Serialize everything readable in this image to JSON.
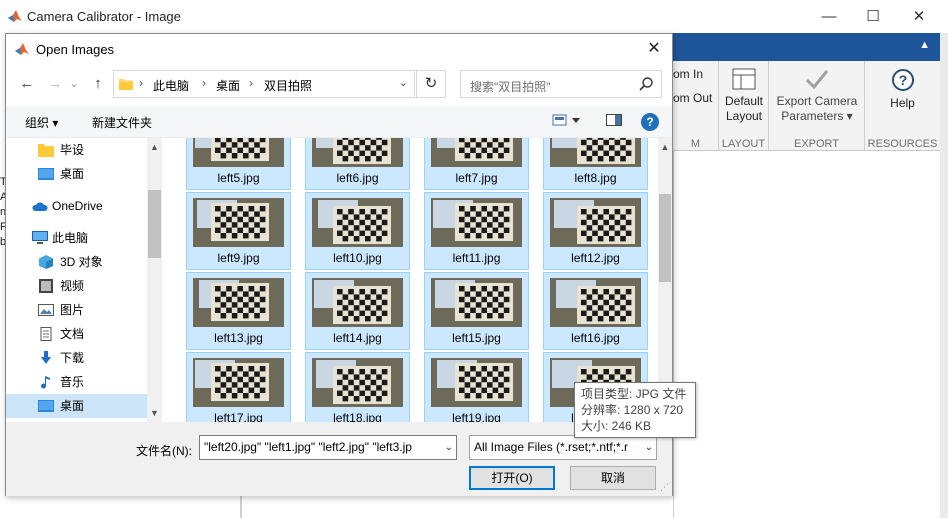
{
  "app": {
    "title": "Camera Calibrator - Image",
    "window_buttons": [
      "—",
      "☐",
      "✕"
    ],
    "ribbon": {
      "partial_labels": [
        "om In",
        "om Out",
        "M"
      ],
      "sections": [
        {
          "label": "LAYOUT",
          "button": "Default\nLayout"
        },
        {
          "label": "EXPORT",
          "button": "Export Camera\nParameters ▾"
        },
        {
          "label": "RESOURCES",
          "button": "Help"
        }
      ]
    },
    "left_strip_chars": [
      "T",
      "A",
      "n",
      "F",
      "b"
    ]
  },
  "dialog": {
    "title": "Open Images",
    "close_glyph": "✕",
    "nav": {
      "back_glyph": "←",
      "forward_glyph": "→",
      "recent_glyph": "⌄",
      "up_glyph": "↑",
      "breadcrumbs": [
        "此电脑",
        "桌面",
        "双目拍照"
      ],
      "search_placeholder": "搜索\"双目拍照\""
    },
    "toolbar": {
      "organize": "组织 ▾",
      "new_folder": "新建文件夹",
      "help": "?"
    },
    "nav_pane": [
      {
        "label": "毕设",
        "icon": "folder-icon"
      },
      {
        "label": "桌面",
        "icon": "desktop-icon"
      },
      {
        "label": "OneDrive",
        "icon": "cloud-icon"
      },
      {
        "label": "此电脑",
        "icon": "computer-icon"
      },
      {
        "label": "3D 对象",
        "icon": "cube-icon"
      },
      {
        "label": "视频",
        "icon": "video-icon"
      },
      {
        "label": "图片",
        "icon": "picture-icon"
      },
      {
        "label": "文档",
        "icon": "document-icon"
      },
      {
        "label": "下载",
        "icon": "download-icon"
      },
      {
        "label": "音乐",
        "icon": "music-icon"
      },
      {
        "label": "桌面",
        "icon": "desktop-icon"
      }
    ],
    "files": [
      [
        "left5.jpg",
        "left6.jpg",
        "left7.jpg",
        "left8.jpg"
      ],
      [
        "left9.jpg",
        "left10.jpg",
        "left11.jpg",
        "left12.jpg"
      ],
      [
        "left13.jpg",
        "left14.jpg",
        "left15.jpg",
        "left16.jpg"
      ],
      [
        "left17.jpg",
        "left18.jpg",
        "left19.jpg",
        "left20.jpg"
      ]
    ],
    "tooltip": {
      "type": "项目类型: JPG 文件",
      "resolution": "分辨率: 1280 x 720",
      "size": "大小: 246 KB"
    },
    "filename_label": "文件名(N):",
    "filename_value": "\"left20.jpg\" \"left1.jpg\" \"left2.jpg\" \"left3.jp",
    "filter_value": "All Image Files (*.rset;*.ntf;*.r",
    "open_button": "打开(O)",
    "cancel_button": "取消"
  }
}
